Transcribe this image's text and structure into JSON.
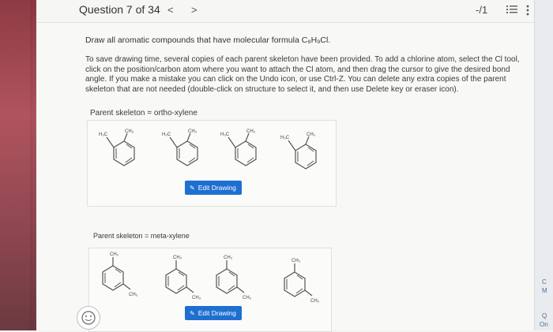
{
  "header": {
    "question_label": "Question 7 of 34",
    "prev_symbol": "<",
    "next_symbol": ">",
    "score": "-/1"
  },
  "prompt": "Draw all aromatic compounds that have molecular formula C₈H₉Cl.",
  "instructions": "To save drawing time, several copies of each parent skeleton have been provided. To add a chlorine atom, select the Cl tool, click on the position/carbon atom where you want to attach the Cl atom, and then drag the cursor to give the desired bond angle. If you make a mistake you can click on the Undo icon, or use Ctrl-Z. You can delete any extra copies of the parent skeleton that are not needed (double-click on structure to select it, and then use Delete key or eraser icon).",
  "sections": [
    {
      "label": "Parent skeleton = ortho-xylene",
      "methyl_left": "H₃C",
      "methyl_right": "CH₃",
      "button_label": "Edit Drawing"
    },
    {
      "label": "Parent skeleton = meta-xylene",
      "methyl_top": "CH₃",
      "methyl_bottom": "CH₃",
      "button_label": "Edit Drawing"
    }
  ],
  "right_edge_text": [
    "C",
    "M",
    "Q",
    "On"
  ],
  "colors": {
    "accent": "#1e6fd0",
    "left_strip": "#9a4750",
    "text": "#333333"
  },
  "icons": {
    "list": "list-icon",
    "more": "more-vertical-icon",
    "edit": "pencil-icon",
    "hint": "hint-icon"
  }
}
